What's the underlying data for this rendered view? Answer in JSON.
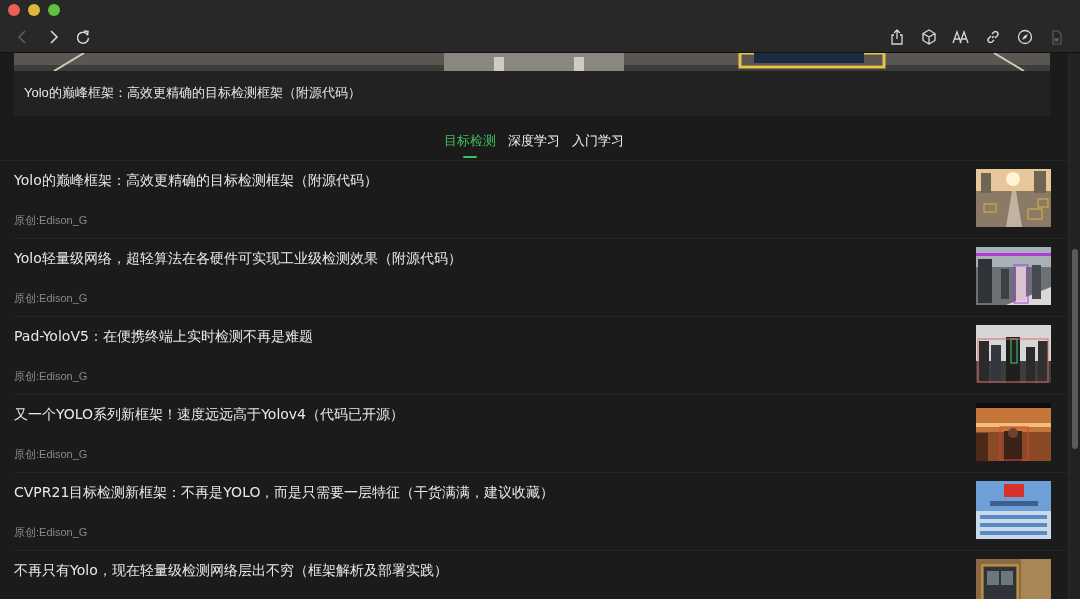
{
  "toolbar": {
    "nav": [
      {
        "kind": "back",
        "disabled": true
      },
      {
        "kind": "forward",
        "disabled": false
      },
      {
        "kind": "reload",
        "disabled": false
      }
    ],
    "actions": [
      {
        "kind": "share",
        "disabled": false
      },
      {
        "kind": "cube",
        "disabled": false
      },
      {
        "kind": "textsize",
        "disabled": false
      },
      {
        "kind": "link",
        "disabled": false
      },
      {
        "kind": "compass",
        "disabled": false
      },
      {
        "kind": "lockpage",
        "disabled": true
      }
    ]
  },
  "banner": {
    "caption": "Yolo的巅峰框架：高效更精确的目标检测框架（附源代码）"
  },
  "tabs": [
    {
      "label": "目标检测",
      "selected": true
    },
    {
      "label": "深度学习",
      "selected": false
    },
    {
      "label": "入门学习",
      "selected": false
    }
  ],
  "articles": [
    {
      "title": "Yolo的巅峰框架：高效更精确的目标检测框架（附源代码）",
      "author": "原创:Edison_G"
    },
    {
      "title": "Yolo轻量级网络，超轻算法在各硬件可实现工业级检测效果（附源代码）",
      "author": "原创:Edison_G"
    },
    {
      "title": "Pad-YoloV5：在便携终端上实时检测不再是难题",
      "author": "原创:Edison_G"
    },
    {
      "title": "又一个YOLO系列新框架！速度远远高于Yolov4（代码已开源）",
      "author": "原创:Edison_G"
    },
    {
      "title": "CVPR21目标检测新框架：不再是YOLO，而是只需要一层特征（干货满满，建议收藏）",
      "author": "原创:Edison_G"
    },
    {
      "title": "不再只有Yolo，现在轻量级检测网络层出不穷（框架解析及部署实践）"
    }
  ]
}
